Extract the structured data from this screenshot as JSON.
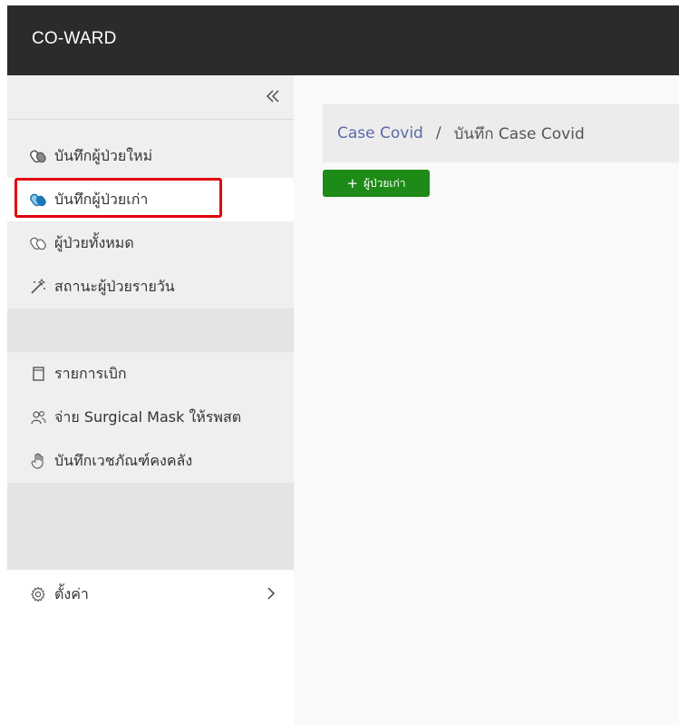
{
  "app": {
    "title": "CO-WARD"
  },
  "sidebar": {
    "items": [
      {
        "label": "บันทึกผู้ป่วยใหม่",
        "icon": "pills-icon"
      },
      {
        "label": "บันทึกผู้ป่วยเก่า",
        "icon": "pills-icon",
        "active": true
      },
      {
        "label": "ผู้ป่วยทั้งหมด",
        "icon": "pills-icon"
      },
      {
        "label": "สถานะผู้ป่วยรายวัน",
        "icon": "magic-wand-icon"
      },
      {
        "label": "รายการเบิก",
        "icon": "document-icon"
      },
      {
        "label": "จ่าย Surgical Mask ให้รพสต",
        "icon": "people-icon"
      },
      {
        "label": "บันทึกเวชภัณฑ์คงคลัง",
        "icon": "hand-icon"
      },
      {
        "label": "ตั้งค่า",
        "icon": "gear-icon"
      }
    ]
  },
  "breadcrumb": {
    "root": "Case Covid",
    "separator": "/",
    "current": "บันทึก Case Covid"
  },
  "toolbar": {
    "add_label": "ผู้ป่วยเก่า"
  },
  "colors": {
    "header": "#2b2b2b",
    "accent_button": "#1e8a17",
    "link": "#5b6aa8",
    "highlight": "#e3000f"
  }
}
